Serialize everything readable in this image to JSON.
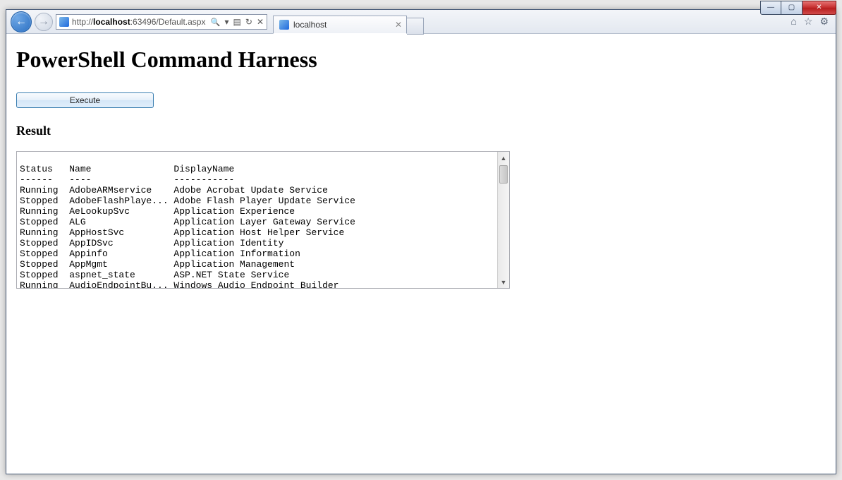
{
  "browser": {
    "url_prefix": "http://",
    "url_host": "localhost",
    "url_rest": ":63496/Default.aspx",
    "tab_title": "localhost"
  },
  "page": {
    "heading": "PowerShell Command Harness",
    "execute_label": "Execute",
    "result_heading": "Result"
  },
  "result_header": {
    "col1": "Status",
    "col2": "Name",
    "col3": "DisplayName"
  },
  "services": [
    {
      "status": "Running",
      "name": "AdobeARMservice",
      "display": "Adobe Acrobat Update Service"
    },
    {
      "status": "Stopped",
      "name": "AdobeFlashPlaye...",
      "display": "Adobe Flash Player Update Service"
    },
    {
      "status": "Running",
      "name": "AeLookupSvc",
      "display": "Application Experience"
    },
    {
      "status": "Stopped",
      "name": "ALG",
      "display": "Application Layer Gateway Service"
    },
    {
      "status": "Running",
      "name": "AppHostSvc",
      "display": "Application Host Helper Service"
    },
    {
      "status": "Stopped",
      "name": "AppIDSvc",
      "display": "Application Identity"
    },
    {
      "status": "Stopped",
      "name": "Appinfo",
      "display": "Application Information"
    },
    {
      "status": "Stopped",
      "name": "AppMgmt",
      "display": "Application Management"
    },
    {
      "status": "Stopped",
      "name": "aspnet_state",
      "display": "ASP.NET State Service"
    },
    {
      "status": "Running",
      "name": "AudioEndpointBu...",
      "display": "Windows Audio Endpoint Builder"
    }
  ]
}
